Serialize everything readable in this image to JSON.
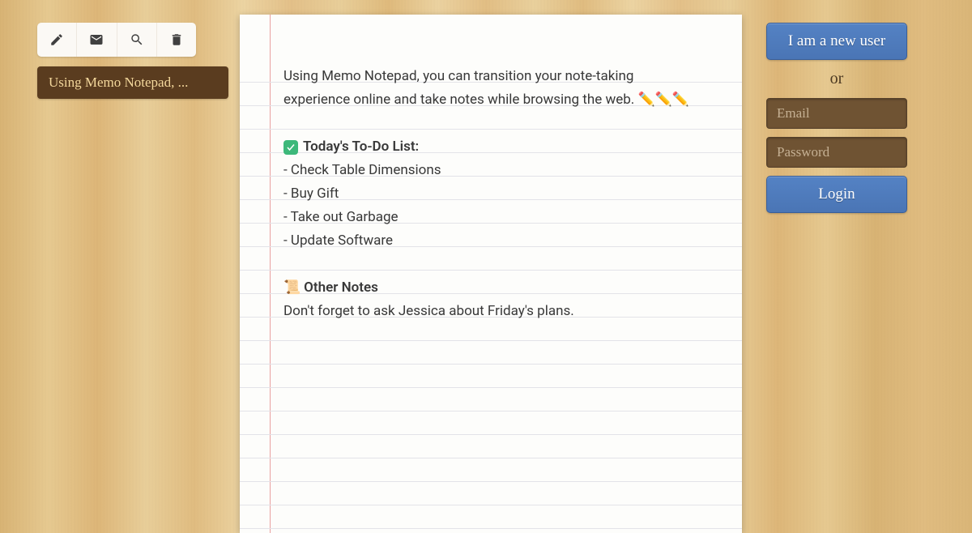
{
  "toolbar": {
    "icons": [
      "edit-icon",
      "mail-icon",
      "search-icon",
      "trash-icon"
    ]
  },
  "sidebar": {
    "notes": [
      {
        "title": "Using Memo Notepad, ..."
      }
    ]
  },
  "note": {
    "intro": "Using Memo Notepad, you can transition your note-taking experience online and take notes while browsing the web. ",
    "pencils": "✏️✏️✏️",
    "todo_header": "Today's To-Do List:",
    "todo_items": [
      "- Check Table Dimensions",
      "- Buy Gift",
      "- Take out Garbage",
      "- Update Software"
    ],
    "other_header": "Other Notes",
    "other_text": "Don't forget to ask Jessica about Friday's plans.",
    "scroll_emoji": "📜"
  },
  "auth": {
    "new_user_label": "I am a new user",
    "or_label": "or",
    "email_placeholder": "Email",
    "password_placeholder": "Password",
    "login_label": "Login"
  }
}
